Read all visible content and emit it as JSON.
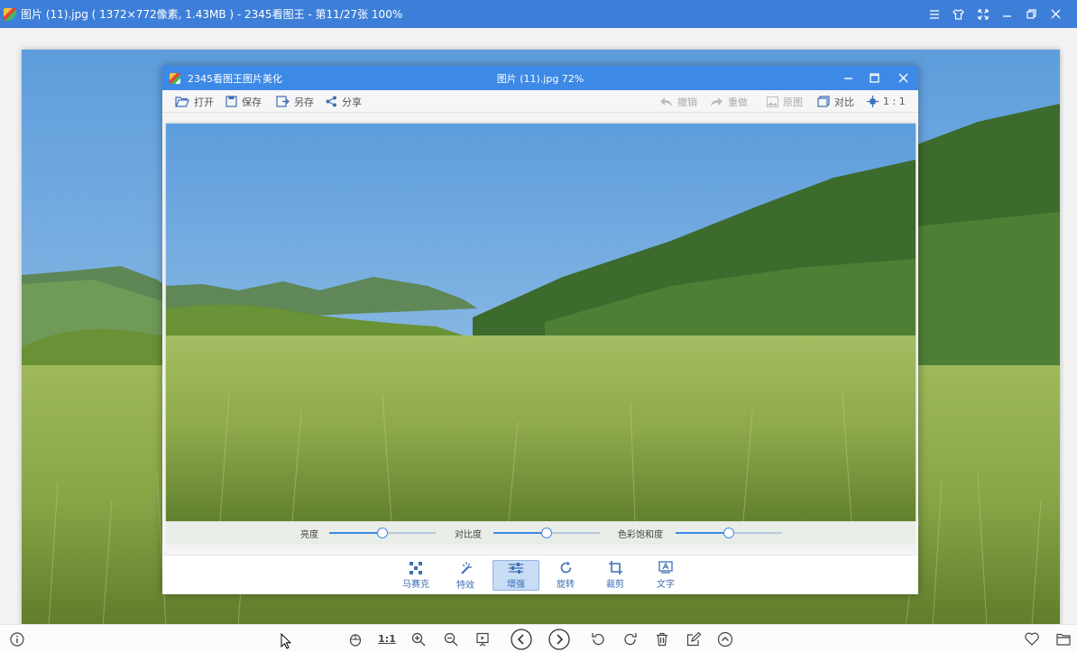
{
  "main_window": {
    "title": "图片 (11).jpg ( 1372×772像素, 1.43MB ) - 2345看图王 - 第11/27张 100%"
  },
  "editor": {
    "app_name": "2345看图王图片美化",
    "file_label": "图片 (11).jpg   72%",
    "toolbar": {
      "open": "打开",
      "save": "保存",
      "save_as": "另存",
      "share": "分享",
      "undo": "撤销",
      "redo": "重做",
      "original": "原图",
      "compare": "对比",
      "one_to_one": "1 : 1"
    },
    "adjust": {
      "brightness": {
        "label": "亮度",
        "value": 0.5
      },
      "contrast": {
        "label": "对比度",
        "value": 0.5
      },
      "saturation": {
        "label": "色彩饱和度",
        "value": 0.5
      }
    },
    "tools": {
      "mosaic": "马赛克",
      "effects": "特效",
      "enhance": "增强",
      "rotate": "旋转",
      "crop": "裁剪",
      "text": "文字"
    }
  },
  "bottom_bar": {
    "one_to_one": "1:1"
  },
  "colors": {
    "title_blue": "#3d7fd8",
    "accent": "#3d89e6"
  }
}
